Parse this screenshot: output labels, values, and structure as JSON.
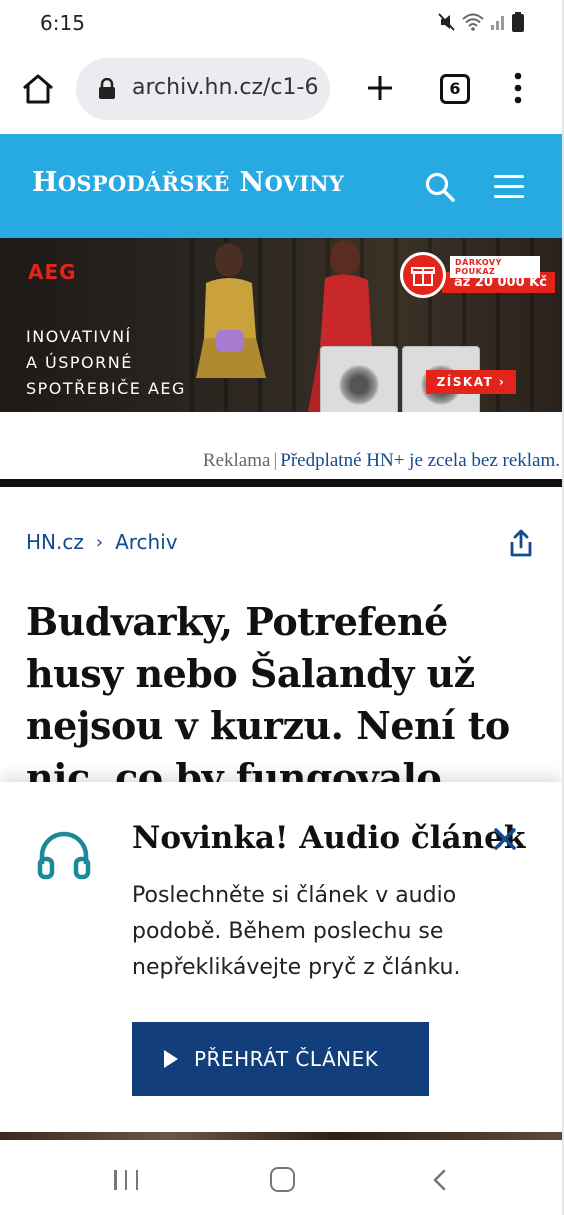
{
  "status_bar": {
    "time": "6:15",
    "icons": [
      "mute-icon",
      "wifi-icon",
      "signal-icon",
      "battery-icon"
    ]
  },
  "browser": {
    "url": "archiv.hn.cz/c1-6",
    "tab_count": "6",
    "icons": [
      "home-icon",
      "lock-icon",
      "plus-icon",
      "more-vert-icon"
    ]
  },
  "site_header": {
    "logo_first": "H",
    "logo_first_rest": "OSPODÁŘSKÉ",
    "logo_second": "N",
    "logo_second_rest": "OVINY",
    "background": "#27a9e1",
    "icons": [
      "search-icon",
      "hamburger-menu-icon"
    ]
  },
  "ad": {
    "brand": "AEG",
    "tagline_lines": [
      "INOVATIVNÍ",
      "A ÚSPORNÉ",
      "SPOTŘEBIČE AEG"
    ],
    "badge_top": "DÁRKOVÝ POUKAZ",
    "badge_value": "až 20 000 Kč",
    "cta": "ZÍSKAT ›",
    "accent": "#e3241b"
  },
  "ad_note": {
    "label": "Reklama",
    "separator": "|",
    "link": "Předplatné HN+ je zcela bez reklam."
  },
  "breadcrumb": {
    "items": [
      "HN.cz",
      "Archiv"
    ],
    "separator": "›"
  },
  "article": {
    "headline_lines": [
      "Budvarky, Potrefené",
      "husy nebo Šalandy už",
      "nejsou v kurzu. Není to",
      "nic, co by fungovalo"
    ]
  },
  "audio_popup": {
    "title": "Novinka! Audio článek",
    "body": "Poslechněte si článek v audio podobě. Během poslechu se nepřeklikávejte pryč z článku.",
    "button_label": "PŘEHRÁT ČLÁNEK",
    "button_color": "#123f7b",
    "icon_color": "#1a8a99",
    "icons": [
      "headphones-icon",
      "close-icon",
      "play-icon"
    ]
  },
  "nav_bar": {
    "icons": [
      "recent-apps-icon",
      "home-nav-icon",
      "back-icon"
    ]
  }
}
